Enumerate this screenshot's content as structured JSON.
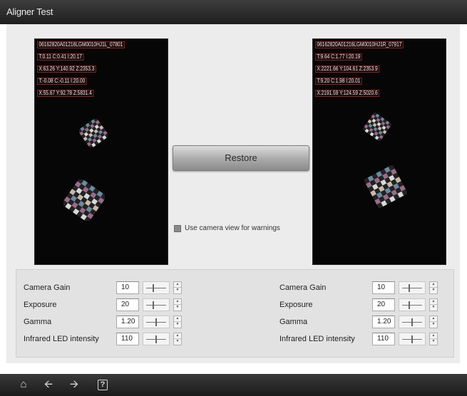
{
  "window": {
    "title": "Aligner Test"
  },
  "cameras": {
    "left": {
      "overlay": [
        "06162820A01216LGM0010HJ1L_07801",
        "T:0.11 C:0.41 I:20.17",
        "X:63.26 Y:140.92 Z:2353.3",
        "T:-0.08 C:-0.11 I:20.00",
        "X:55.67 Y:92.78 Z:5831.4"
      ]
    },
    "right": {
      "overlay": [
        "06162820A01216LGM0010HJ1R_07917",
        "T:9.64 C:1.77 I:20.19",
        "X:2221.66 Y:104.61 Z:2353.9",
        "T:9.20 C:1.98 I:20.01",
        "X:2191.59 Y:124.59 Z:5020.6"
      ]
    }
  },
  "restore_label": "Restore",
  "warnings_checkbox": {
    "label": "Use camera view for warnings",
    "checked": false
  },
  "controls": {
    "left": [
      {
        "label": "Camera Gain",
        "value": "10",
        "slider_level": 0.35
      },
      {
        "label": "Exposure",
        "value": "20",
        "slider_level": 0.35
      },
      {
        "label": "Gamma",
        "value": "1.20",
        "slider_level": 0.5
      },
      {
        "label": "Infrared LED intensity",
        "value": "110",
        "slider_level": 0.5
      }
    ],
    "right": [
      {
        "label": "Camera Gain",
        "value": "10",
        "slider_level": 0.35
      },
      {
        "label": "Exposure",
        "value": "20",
        "slider_level": 0.35
      },
      {
        "label": "Gamma",
        "value": "1.20",
        "slider_level": 0.5
      },
      {
        "label": "Infrared LED intensity",
        "value": "110",
        "slider_level": 0.5
      }
    ]
  },
  "toolbar": {
    "home_icon": "home-icon",
    "back_icon": "back-arrow-icon",
    "forward_icon": "forward-arrow-icon",
    "help_label": "?"
  },
  "colors": {
    "title_bar": "#262626",
    "background": "#ececec",
    "camera_view": "#060606",
    "overlay_border": "#8a2020"
  }
}
